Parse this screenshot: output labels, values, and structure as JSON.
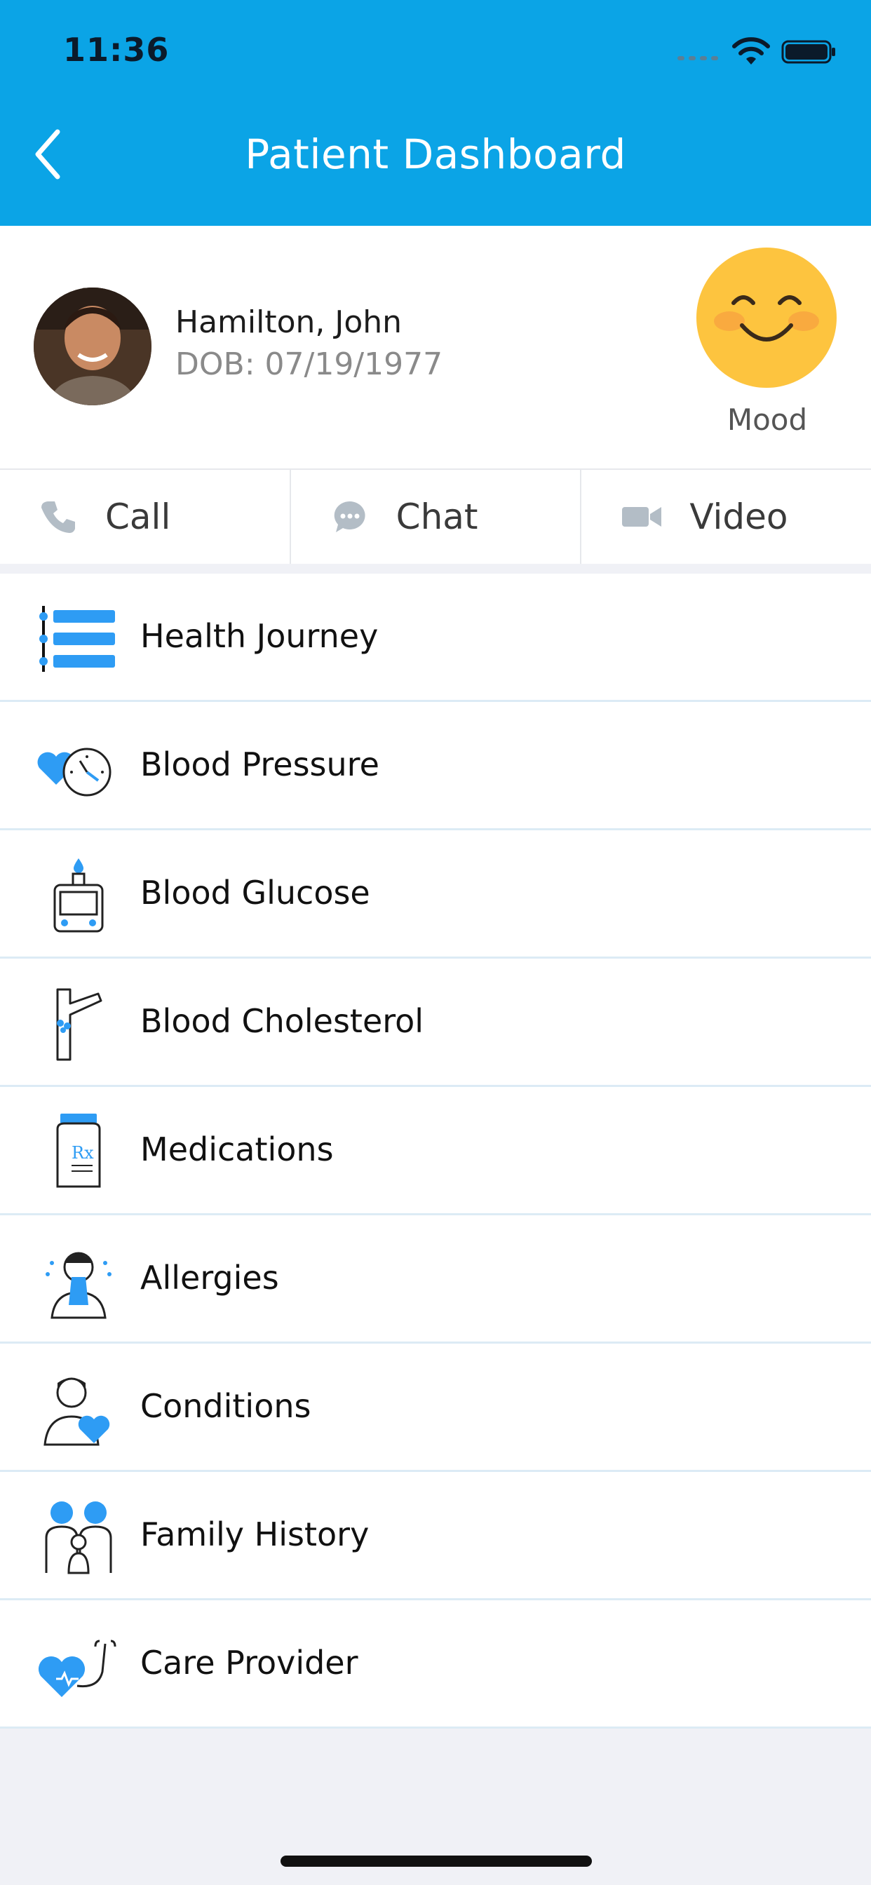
{
  "status_bar": {
    "time": "11:36"
  },
  "header": {
    "title": "Patient Dashboard"
  },
  "patient": {
    "name": "Hamilton, John",
    "dob": "DOB: 07/19/1977"
  },
  "mood": {
    "label": "Mood"
  },
  "actions": [
    {
      "label": "Call",
      "icon": "phone-icon"
    },
    {
      "label": "Chat",
      "icon": "chat-icon"
    },
    {
      "label": "Video",
      "icon": "video-icon"
    }
  ],
  "menu": [
    {
      "label": "Health Journey",
      "icon": "health-journey-icon"
    },
    {
      "label": "Blood Pressure",
      "icon": "blood-pressure-icon"
    },
    {
      "label": "Blood Glucose",
      "icon": "glucometer-icon"
    },
    {
      "label": "Blood Cholesterol",
      "icon": "artery-icon"
    },
    {
      "label": "Medications",
      "icon": "pill-bottle-icon"
    },
    {
      "label": "Allergies",
      "icon": "sneezing-person-icon"
    },
    {
      "label": "Conditions",
      "icon": "person-heart-icon"
    },
    {
      "label": "Family History",
      "icon": "family-icon"
    },
    {
      "label": "Care Provider",
      "icon": "stethoscope-heart-icon"
    }
  ],
  "colors": {
    "header": "#0ba4e6",
    "icon_blue": "#2e9cf4",
    "mood_face": "#fdc43f"
  }
}
